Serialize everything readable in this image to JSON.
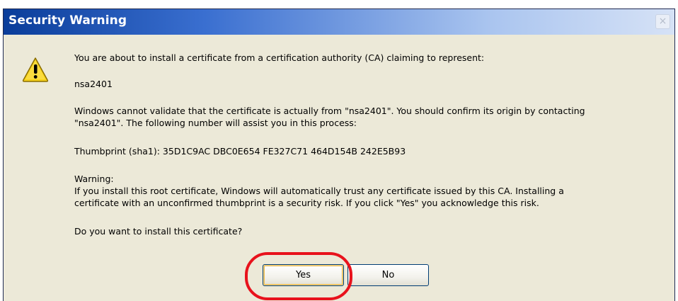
{
  "window": {
    "title": "Security Warning",
    "close_glyph": "×"
  },
  "icons": {
    "warning": "warning-icon",
    "close": "close-icon"
  },
  "message": {
    "intro": "You are about to install a certificate from a certification authority (CA) claiming to represent:",
    "name": "nsa2401",
    "validate": "Windows cannot validate that the certificate is actually from \"nsa2401\". You should confirm its origin by contacting\n\"nsa2401\". The following number will assist you in this process:",
    "thumbprint": "Thumbprint (sha1): 35D1C9AC DBC0E654 FE327C71 464D154B 242E5B93",
    "warning_label": "Warning:",
    "warning_body": "If you install this root certificate, Windows will automatically trust any certificate issued by this CA. Installing a\ncertificate with an unconfirmed thumbprint is a security risk. If you click \"Yes\" you acknowledge this risk.",
    "question": "Do you want to install this certificate?"
  },
  "buttons": {
    "yes": "Yes",
    "no": "No"
  },
  "colors": {
    "titlebar_start": "#0a3d9a",
    "titlebar_end": "#d6e2f6",
    "dialog_bg": "#ece9d8",
    "highlight": "#e8121c",
    "warning_yellow": "#f7d21b"
  }
}
